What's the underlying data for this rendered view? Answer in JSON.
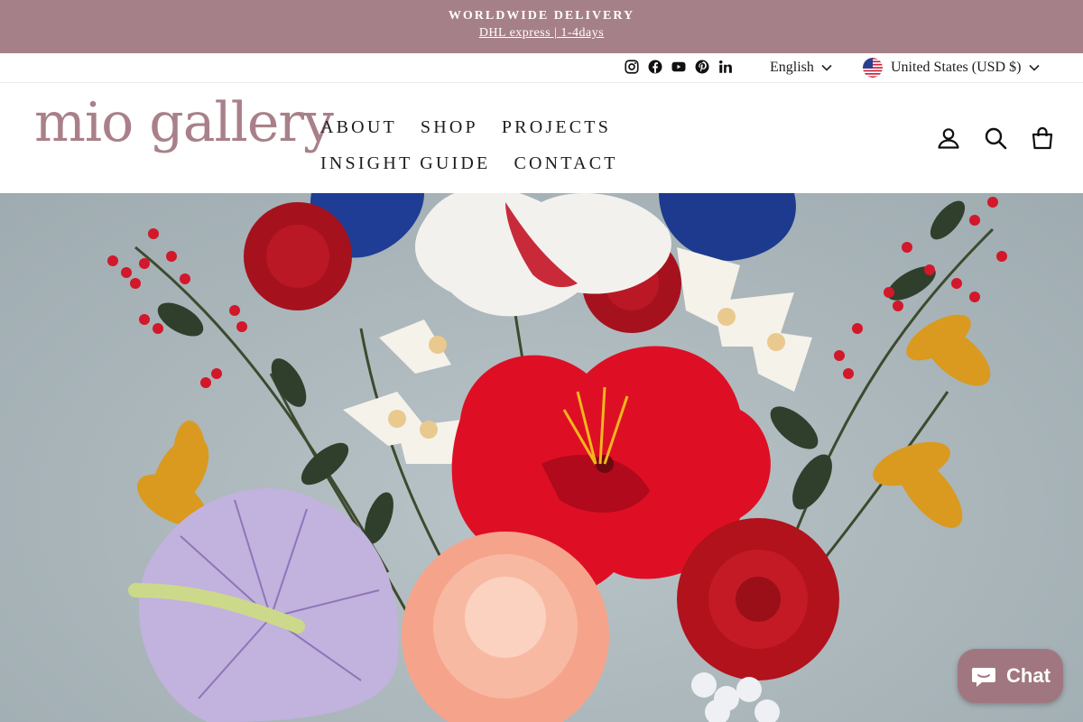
{
  "announcement": {
    "headline": "WORLDWIDE DELIVERY",
    "subline": "DHL express | 1-4days"
  },
  "utility": {
    "social_icons": [
      "instagram-icon",
      "facebook-icon",
      "youtube-icon",
      "pinterest-icon",
      "linkedin-icon"
    ],
    "language": "English",
    "currency": "United States (USD $)"
  },
  "header": {
    "logo": "mio gallery",
    "nav": [
      "ABOUT",
      "SHOP",
      "PROJECTS",
      "INSIGHT GUIDE",
      "CONTACT"
    ],
    "icons": [
      "account-icon",
      "search-icon",
      "cart-icon"
    ]
  },
  "hero": {
    "image": "paper-flower-bouquet-image"
  },
  "chat": {
    "label": "Chat"
  },
  "colors": {
    "brand": "#a68089",
    "text": "#1c1c1c",
    "chat": "#a07780"
  }
}
